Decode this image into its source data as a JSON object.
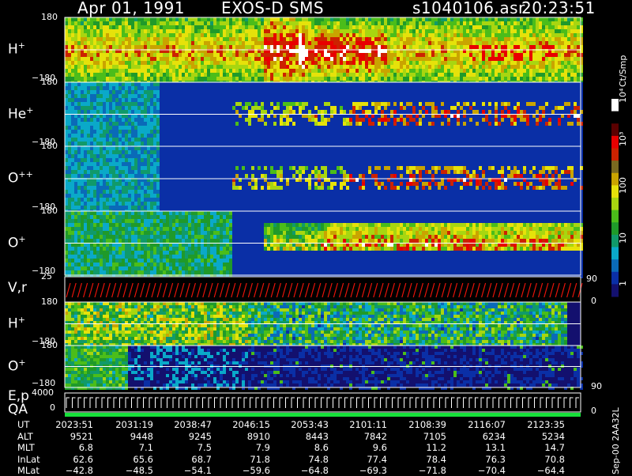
{
  "header": {
    "date": "Apr 01, 1991",
    "mission": "EXOS-D SMS",
    "file": "s1040106.asr",
    "time": "20:23:51"
  },
  "chart_data": {
    "type": "heatmap",
    "panels": [
      {
        "name": "H",
        "sup": "+",
        "ytop": "180",
        "ybot": "−180"
      },
      {
        "name": "He",
        "sup": "+",
        "ytop": "180",
        "ybot": "−180"
      },
      {
        "name": "O",
        "sup": "++",
        "ytop": "180",
        "ybot": "−180"
      },
      {
        "name": "O",
        "sup": "+",
        "ytop": "180",
        "ybot": "−180"
      },
      {
        "name": "V,r",
        "sup": "",
        "ytop": "25",
        "ybot": "",
        "right_top": "90",
        "right_bot": "0"
      },
      {
        "name": "H",
        "sup": "+",
        "ytop": "180",
        "ybot": "−180"
      },
      {
        "name": "O",
        "sup": "+",
        "ytop": "180",
        "ybot": "−180",
        "right_bot": "90"
      },
      {
        "name": "E,p",
        "sup": "",
        "ytop": "4000",
        "ybot": "0",
        "right_bot": "0"
      }
    ],
    "qa_label": "QA",
    "colorbar": {
      "title": "Ct/Smp",
      "ticks": [
        "1",
        "10",
        "100",
        "10³",
        "10⁴"
      ]
    },
    "side_label": "Sep-00 2AA32L",
    "table": {
      "UT": [
        "2023:51",
        "2031:19",
        "2038:47",
        "2046:15",
        "2053:43",
        "2101:11",
        "2108:39",
        "2116:07",
        "2123:35"
      ],
      "ALT": [
        "9521",
        "9448",
        "9245",
        "8910",
        "8443",
        "7842",
        "7105",
        "6234",
        "5234"
      ],
      "MLT": [
        "6.8",
        "7.1",
        "7.5",
        "7.9",
        "8.6",
        "9.6",
        "11.2",
        "13.1",
        "14.7"
      ],
      "InLat": [
        "62.6",
        "65.6",
        "68.7",
        "71.8",
        "74.8",
        "77.4",
        "78.4",
        "76.3",
        "70.8"
      ],
      "MLat": [
        "−42.8",
        "−48.5",
        "−54.1",
        "−59.6",
        "−64.8",
        "−69.3",
        "−71.8",
        "−70.4",
        "−64.4"
      ]
    },
    "row_names": [
      "UT",
      "ALT",
      "MLT",
      "InLat",
      "MLat"
    ]
  }
}
